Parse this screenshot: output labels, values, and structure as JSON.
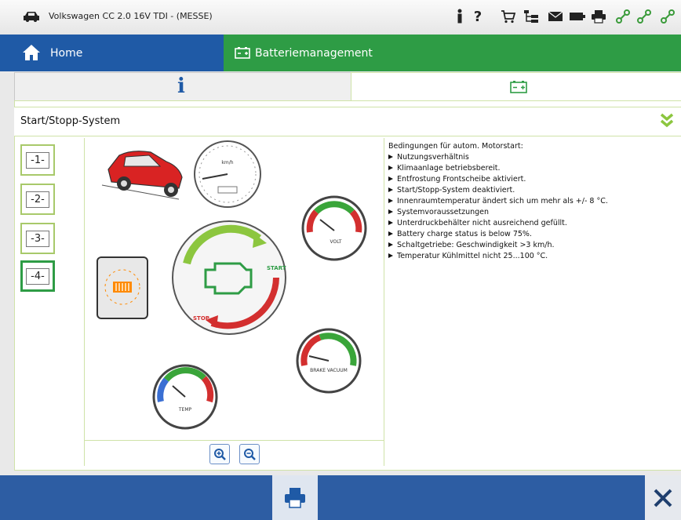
{
  "window": {
    "title": "Volkswagen CC 2.0 16V TDI - (MESSE)"
  },
  "nav": {
    "home_label": "Home",
    "battery_label": "Batteriemanagement"
  },
  "tabs": {
    "info_label": "i"
  },
  "section": {
    "title": "Start/Stopp-System"
  },
  "side_buttons": [
    "-1-",
    "-2-",
    "-3-",
    "-4-"
  ],
  "gauges": {
    "speed_label": "km/h",
    "volt_label": "VOLT",
    "brake_label": "BRAKE VACUUM",
    "temp_label": "TEMP"
  },
  "engine": {
    "start_label": "START",
    "stop_label": "STOP"
  },
  "conditions": {
    "title": "Bedingungen für autom. Motorstart:",
    "items": [
      "Nutzungsverhältnis",
      "Klimaanlage betriebsbereit.",
      "Entfrostung Frontscheibe aktiviert.",
      "Start/Stopp-System deaktiviert.",
      "Innenraumtemperatur ändert sich um mehr als +/- 8 °C.",
      "Systemvoraussetzungen",
      "Unterdruckbehälter nicht ausreichend gefüllt.",
      "Battery charge status is below 75%.",
      "Schaltgetriebe: Geschwindigkeit >3 km/h.",
      "Temperatur Kühlmittel nicht 25...100 °C."
    ]
  },
  "colors": {
    "nav_home": "#1f5aa6",
    "nav_battery": "#2e9c45",
    "bottom_bar": "#2d5da3",
    "accent_green": "#2e9c45",
    "border_green": "#a8c96a"
  }
}
